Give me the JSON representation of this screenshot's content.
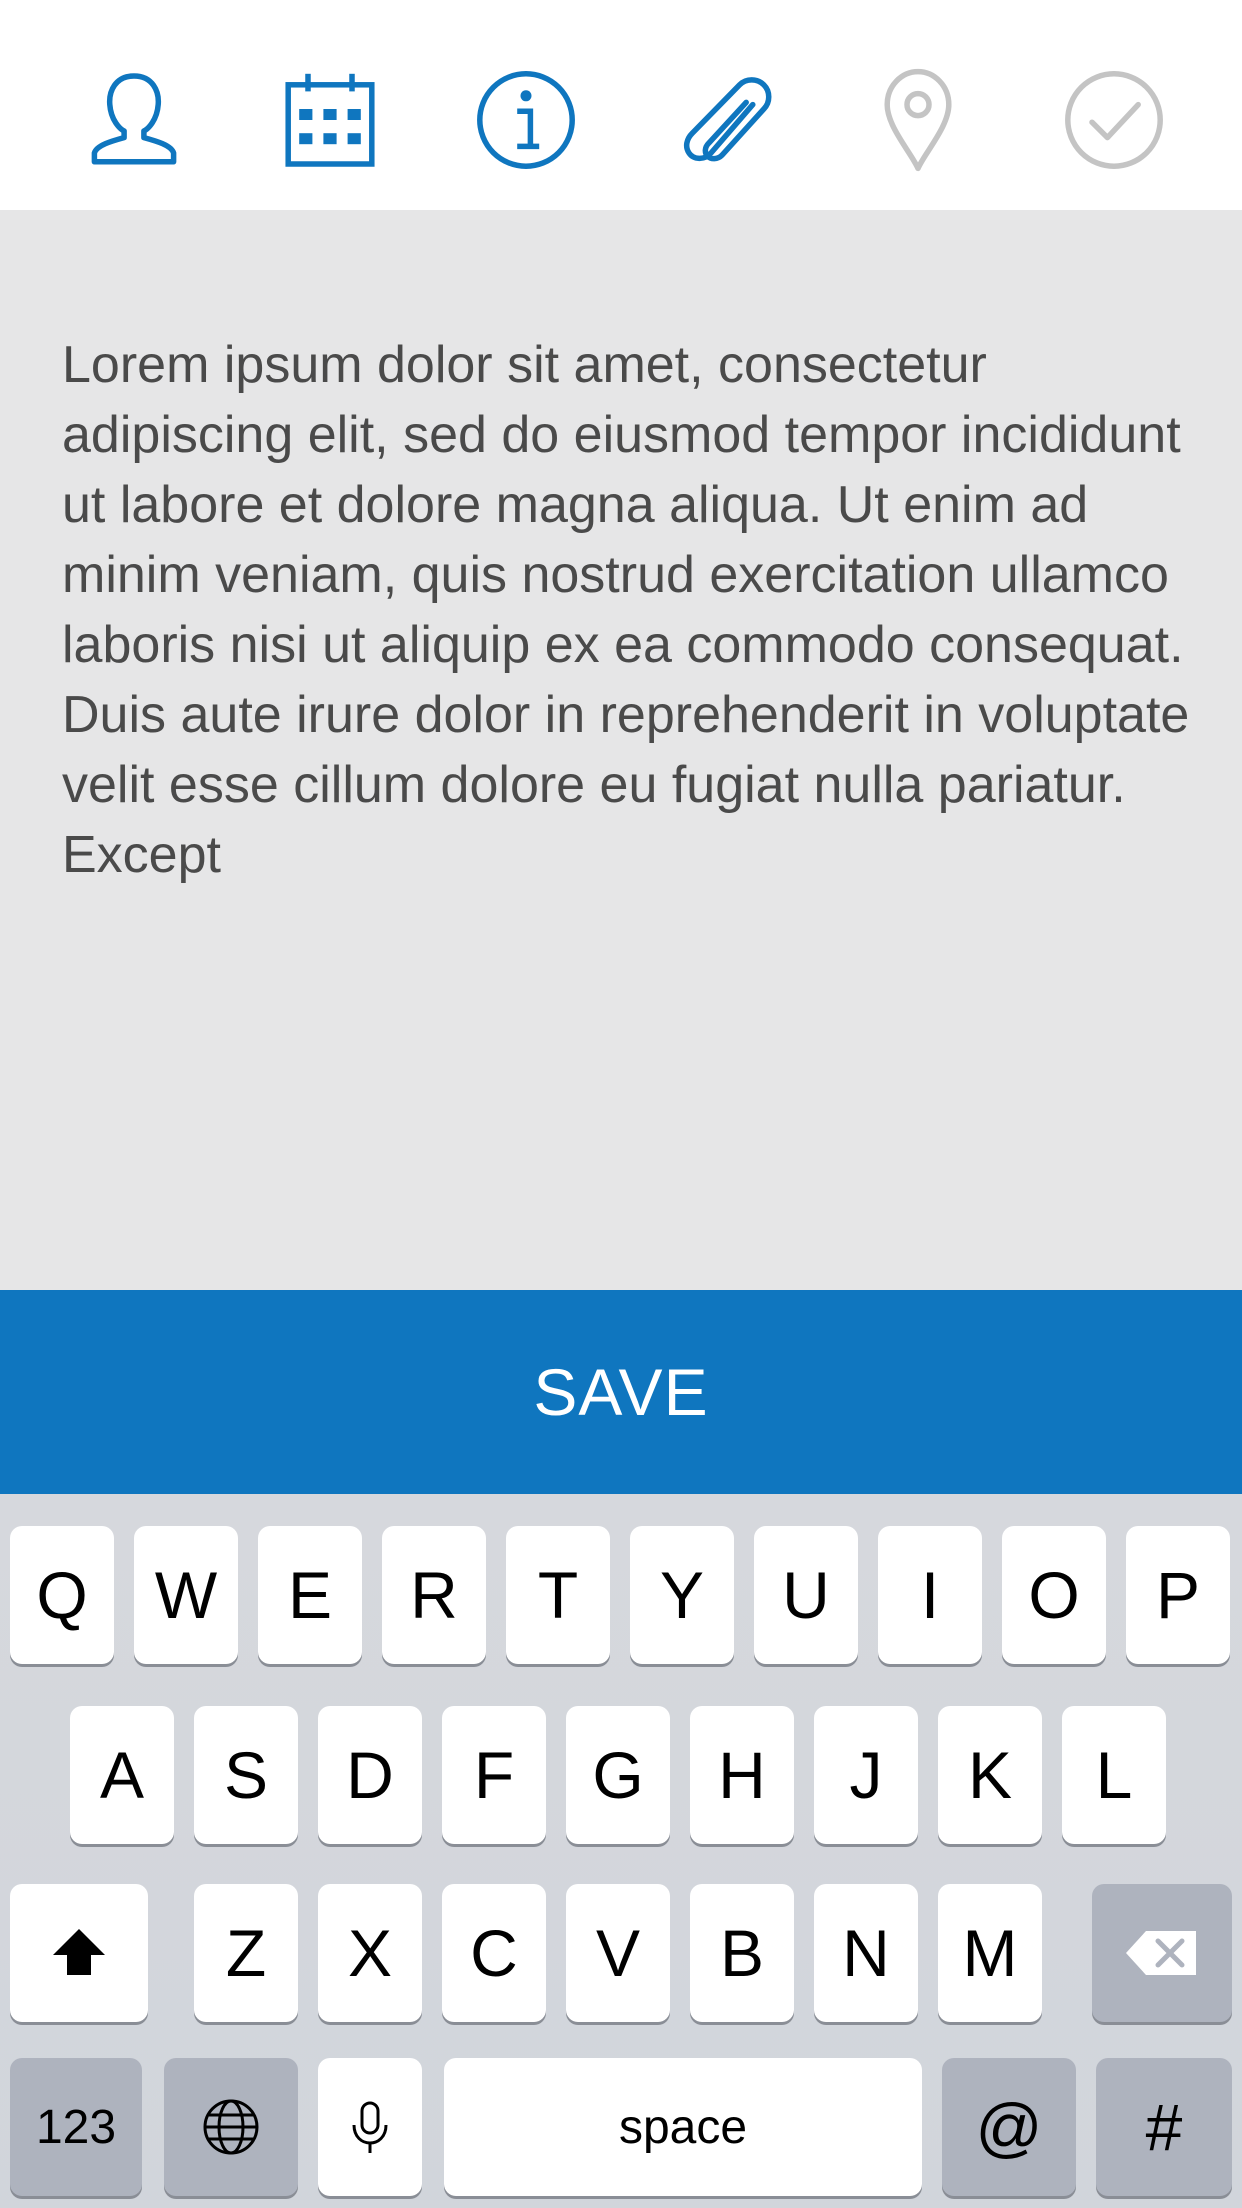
{
  "tabs": [
    {
      "name": "contact",
      "icon": "person-icon",
      "active": true
    },
    {
      "name": "calendar",
      "icon": "calendar-icon",
      "active": true
    },
    {
      "name": "info",
      "icon": "info-icon",
      "active": true
    },
    {
      "name": "attachment",
      "icon": "paperclip-icon",
      "active": true,
      "selected": true
    },
    {
      "name": "location",
      "icon": "location-pin-icon",
      "active": false
    },
    {
      "name": "confirm",
      "icon": "checkmark-circle-icon",
      "active": false
    }
  ],
  "colors": {
    "accent": "#0f76bf",
    "inactive_icon": "#c4c4c4",
    "panel_bg": "#e6e6e7",
    "text": "#4a4a4a"
  },
  "notes": {
    "text": "Lorem ipsum dolor sit amet, consectetur adipiscing elit, sed do eiusmod tempor incididunt ut labore et dolore magna aliqua. Ut enim ad minim veniam, quis nostrud exercitation ullamco laboris nisi ut aliquip ex ea commodo consequat. Duis aute irure dolor in reprehenderit in voluptate velit esse cillum dolore eu fugiat nulla pariatur. Except"
  },
  "save_button": {
    "label": "SAVE"
  },
  "keyboard": {
    "row1": [
      "Q",
      "W",
      "E",
      "R",
      "T",
      "Y",
      "U",
      "I",
      "O",
      "P"
    ],
    "row2": [
      "A",
      "S",
      "D",
      "F",
      "G",
      "H",
      "J",
      "K",
      "L"
    ],
    "row3": [
      "Z",
      "X",
      "C",
      "V",
      "B",
      "N",
      "M"
    ],
    "shift_icon": "shift-arrow-icon",
    "delete_icon": "backspace-icon",
    "numbers_label": "123",
    "globe_icon": "globe-icon",
    "mic_icon": "microphone-icon",
    "space_label": "space",
    "at_label": "@",
    "hash_label": "#"
  }
}
